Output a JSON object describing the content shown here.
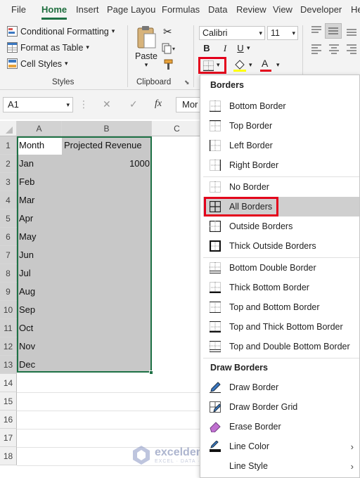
{
  "menu": {
    "tabs": [
      "File",
      "Home",
      "Insert",
      "Page Layou",
      "Formulas",
      "Data",
      "Review",
      "View",
      "Developer",
      "He"
    ],
    "active": "Home"
  },
  "ribbon": {
    "styles": {
      "conditional_formatting": "Conditional Formatting",
      "format_as_table": "Format as Table",
      "cell_styles": "Cell Styles",
      "label": "Styles"
    },
    "clipboard": {
      "paste": "Paste",
      "label": "Clipboard"
    },
    "font": {
      "name": "Calibri",
      "size": "11",
      "bold": "B",
      "italic": "I",
      "underline": "U",
      "font_color_glyph": "A"
    }
  },
  "formula_bar": {
    "name_box": "A1",
    "fx": "fx",
    "content": "Mor"
  },
  "sheet": {
    "columns": [
      "A",
      "B",
      "C"
    ],
    "rows": [
      "1",
      "2",
      "3",
      "4",
      "5",
      "6",
      "7",
      "8",
      "9",
      "10",
      "11",
      "12",
      "13",
      "14",
      "15",
      "16",
      "17",
      "18"
    ],
    "cells": {
      "a1": "Month",
      "b1": "Projected Revenue",
      "a2": "Jan",
      "b2": "1000",
      "months": [
        "Feb",
        "Mar",
        "Apr",
        "May",
        "Jun",
        "Jul",
        "Aug",
        "Sep",
        "Oct",
        "Nov",
        "Dec"
      ]
    },
    "selection_color": "#c8c8c8",
    "selection_border": "#1e7145"
  },
  "dropdown": {
    "borders_title": "Borders",
    "bottom_border": "Bottom Border",
    "top_border": "Top Border",
    "left_border": "Left Border",
    "right_border": "Right Border",
    "no_border": "No Border",
    "all_borders": "All Borders",
    "outside_borders": "Outside Borders",
    "thick_outside_borders": "Thick Outside Borders",
    "bottom_double_border": "Bottom Double Border",
    "thick_bottom_border": "Thick Bottom Border",
    "top_and_bottom_border": "Top and Bottom Border",
    "top_and_thick_bottom_border": "Top and Thick Bottom Border",
    "top_and_double_bottom_border": "Top and Double Bottom Border",
    "draw_borders_title": "Draw Borders",
    "draw_border": "Draw Border",
    "draw_border_grid": "Draw Border Grid",
    "erase_border": "Erase Border",
    "line_color": "Line Color",
    "line_style": "Line Style",
    "highlight_color": "#e3001b"
  },
  "watermark": {
    "name": "exceldemy",
    "tagline": "EXCEL · DATA · BI"
  }
}
